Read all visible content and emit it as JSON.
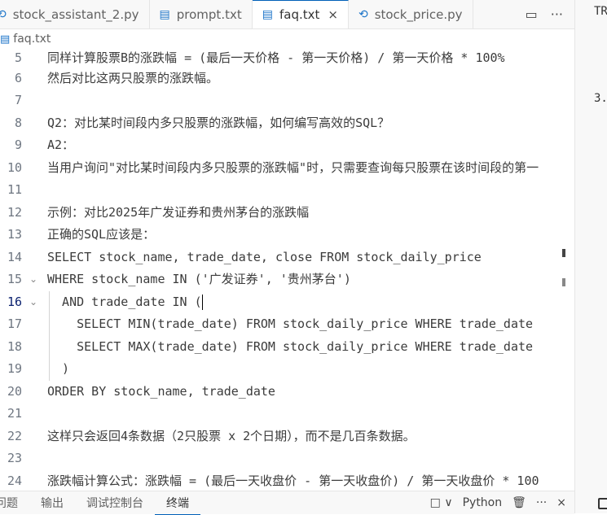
{
  "tabs": [
    {
      "label": "stock_assistant_2.py",
      "icon": "python-icon",
      "active": false
    },
    {
      "label": "prompt.txt",
      "icon": "text-file-icon",
      "active": false
    },
    {
      "label": "faq.txt",
      "icon": "text-file-icon",
      "active": true,
      "close": "×"
    },
    {
      "label": "stock_price.py",
      "icon": "python-icon",
      "active": false
    }
  ],
  "tab_actions": {
    "split": "▭",
    "more": "···"
  },
  "breadcrumb": {
    "file": "faq.txt"
  },
  "lines": [
    {
      "n": "5",
      "text": "同样计算股票B的涨跌幅 = (最后一天价格 - 第一天价格) / 第一天价格 * 100%"
    },
    {
      "n": "6",
      "text": "然后对比这两只股票的涨跌幅。"
    },
    {
      "n": "7",
      "text": ""
    },
    {
      "n": "8",
      "text": "Q2：对比某时间段内多只股票的涨跌幅，如何编写高效的SQL？"
    },
    {
      "n": "9",
      "text": "A2："
    },
    {
      "n": "10",
      "text": "当用户询问\"对比某时间段内多只股票的涨跌幅\"时，只需要查询每只股票在该时间段的第一"
    },
    {
      "n": "11",
      "text": ""
    },
    {
      "n": "12",
      "text": "示例：对比2025年广发证券和贵州茅台的涨跌幅"
    },
    {
      "n": "13",
      "text": "正确的SQL应该是："
    },
    {
      "n": "14",
      "text": "SELECT stock_name, trade_date, close FROM stock_daily_price"
    },
    {
      "n": "15",
      "text": "WHERE stock_name IN ('广发证券', '贵州茅台')",
      "fold": "⌄"
    },
    {
      "n": "16",
      "text": "  AND trade_date IN (",
      "fold": "⌄",
      "current": true
    },
    {
      "n": "17",
      "text": "    SELECT MIN(trade_date) FROM stock_daily_price WHERE trade_date"
    },
    {
      "n": "18",
      "text": "    SELECT MAX(trade_date) FROM stock_daily_price WHERE trade_date"
    },
    {
      "n": "19",
      "text": "  )"
    },
    {
      "n": "20",
      "text": "ORDER BY stock_name, trade_date"
    },
    {
      "n": "21",
      "text": ""
    },
    {
      "n": "22",
      "text": "这样只会返回4条数据（2只股票 x 2个日期），而不是几百条数据。"
    },
    {
      "n": "23",
      "text": ""
    },
    {
      "n": "24",
      "text": "涨跌幅计算公式：涨跌幅 = (最后一天收盘价 - 第一天收盘价) / 第一天收盘价 * 100"
    }
  ],
  "right_panel": {
    "line1": "TR",
    "line2": "3."
  },
  "bottom_tabs": [
    {
      "label": "问题",
      "active": false
    },
    {
      "label": "输出",
      "active": false
    },
    {
      "label": "调试控制台",
      "active": false
    },
    {
      "label": "终端",
      "active": true
    }
  ],
  "bottom_actions": {
    "layout": "□ ∨",
    "lang": "Python",
    "trash": "🗑",
    "more": "···",
    "close": "×"
  }
}
